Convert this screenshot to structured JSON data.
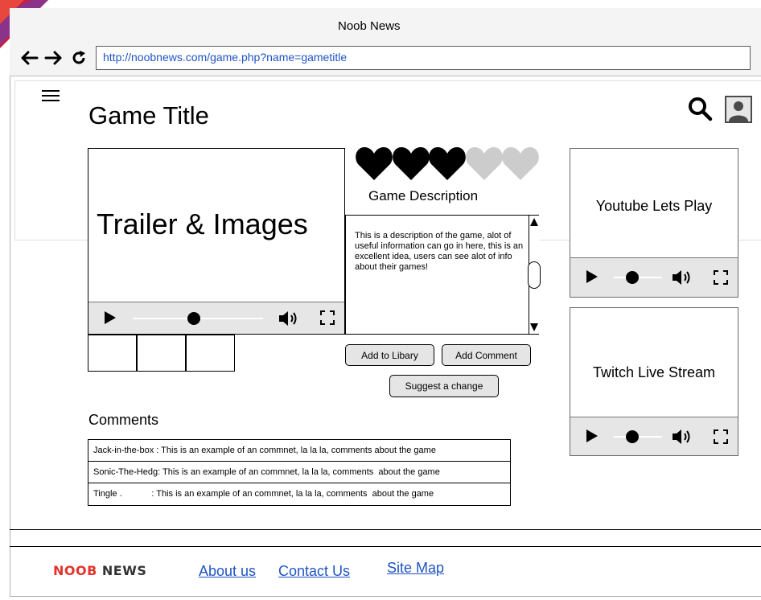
{
  "window": {
    "title": "Noob News"
  },
  "browser": {
    "url": "http://noobnews.com/game.php?name=gametitle"
  },
  "page": {
    "title": "Game Title"
  },
  "trailer": {
    "label": "Trailer & Images"
  },
  "rating": {
    "filled": 3,
    "total": 5,
    "filled_color": "#000000",
    "empty_color": "#cccccc"
  },
  "description": {
    "heading": "Game Description",
    "body": "This is a description of the game, alot of useful information can go in here, this is an excellent idea, users can see alot of info about their games!"
  },
  "actions": {
    "add_library": "Add to Libary",
    "add_comment": "Add Comment",
    "suggest_change": "Suggest a change"
  },
  "side_panels": {
    "youtube": "Youtube Lets Play",
    "twitch": "Twitch Live Stream"
  },
  "comments": {
    "heading": "Comments",
    "items": [
      {
        "text": "Jack-in-the-box : This is an example of an commnet, la la la, comments  about the game"
      },
      {
        "text": "Sonic-The-Hedg: This is an example of an commnet, la la la, comments  about the game"
      },
      {
        "text": "Tingle .            : This is an example of an commnet, la la la, comments  about the game"
      }
    ]
  },
  "footer": {
    "logo": "NOOB NEWS",
    "links": {
      "about": "About us",
      "contact": "Contact Us",
      "sitemap": "Site Map"
    }
  },
  "colors": {
    "link": "#2054c4",
    "logo_red": "#e2332b",
    "logo_dark": "#333333"
  },
  "icons": [
    "back-arrow-icon",
    "forward-arrow-icon",
    "reload-icon",
    "hamburger-icon",
    "search-icon",
    "user-avatar-icon",
    "play-icon",
    "volume-icon",
    "fullscreen-icon",
    "heart-icon"
  ]
}
